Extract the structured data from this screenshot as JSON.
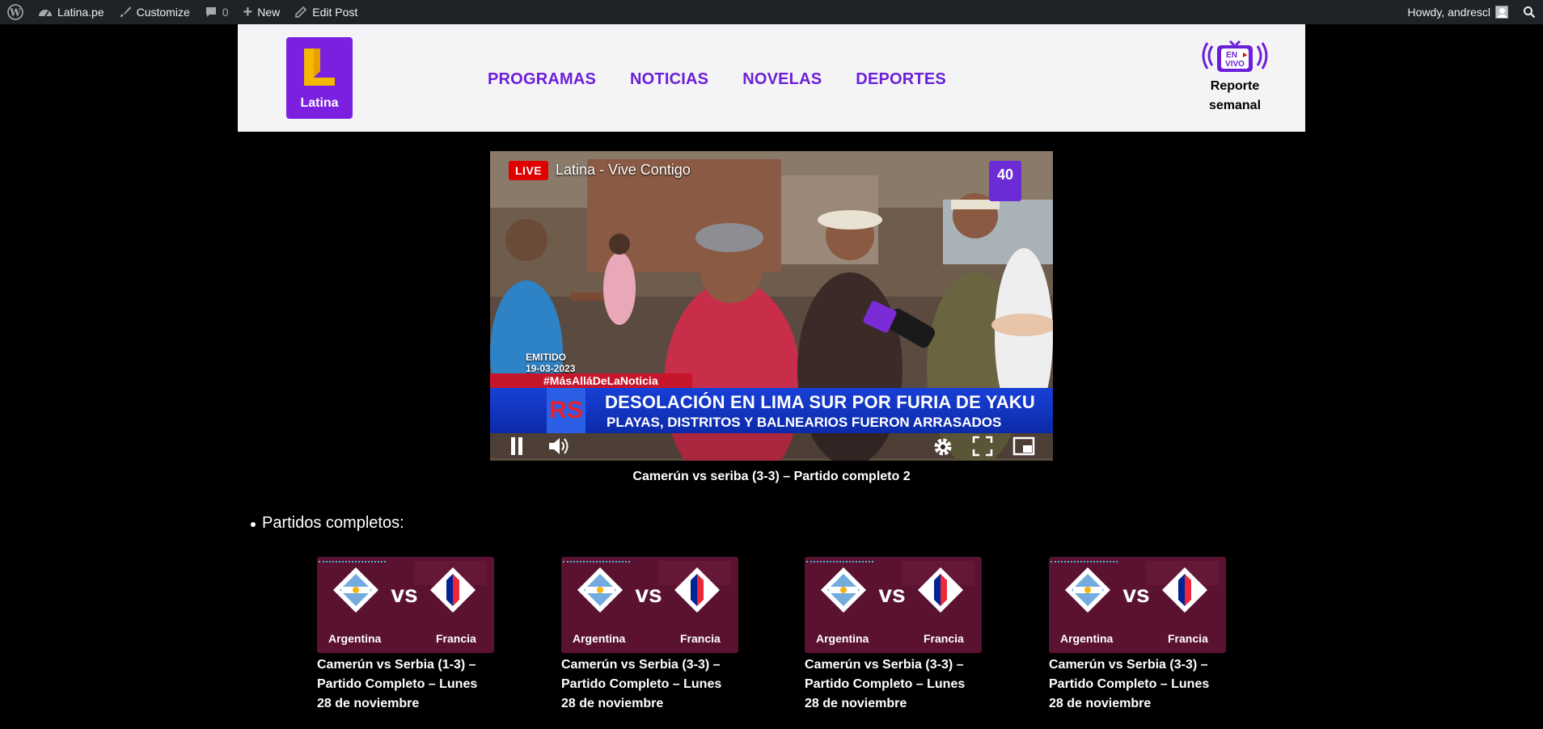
{
  "adminbar": {
    "site_name": "Latina.pe",
    "customize": "Customize",
    "comments_count": "0",
    "new": "New",
    "edit_post": "Edit Post",
    "greeting": "Howdy, andrescl"
  },
  "header": {
    "logo_text": "Latina",
    "nav": [
      "PROGRAMAS",
      "NOTICIAS",
      "NOVELAS",
      "DEPORTES"
    ],
    "envivo_badge": [
      "EN",
      "VIVO"
    ],
    "report_label": "Reporte semanal"
  },
  "player": {
    "live_badge": "LIVE",
    "stream_title": "Latina - Vive Contigo",
    "channel_badge": "40",
    "emitido_label": "EMITIDO",
    "emitido_date": "19-03-2023",
    "hashtag": "#MásAlláDeLaNoticia",
    "rs_logo": "RS",
    "headline_1": "DESOLACIÓN EN LIMA SUR POR FURIA DE YAKU",
    "headline_2": "PLAYAS, DISTRITOS Y BALNEARIOS FUERON ARRASADOS",
    "caption": "Camerún vs seriba (3-3) – Partido completo 2"
  },
  "section": {
    "title": "Partidos completos:"
  },
  "cards": [
    {
      "team_left": "Argentina",
      "vs": "vs",
      "team_right": "Francia",
      "title": "Camerún vs Serbia (1-3) – Partido Completo – Lunes 28 de noviembre"
    },
    {
      "team_left": "Argentina",
      "vs": "vs",
      "team_right": "Francia",
      "title": "Camerún vs Serbia (3-3) – Partido Completo – Lunes 28 de noviembre"
    },
    {
      "team_left": "Argentina",
      "vs": "vs",
      "team_right": "Francia",
      "title": "Camerún vs Serbia (3-3) – Partido Completo – Lunes 28 de noviembre"
    },
    {
      "team_left": "Argentina",
      "vs": "vs",
      "team_right": "Francia",
      "title": "Camerún vs Serbia (3-3) – Partido Completo – Lunes 28 de noviembre"
    }
  ],
  "colors": {
    "brand_purple": "#6b1fd8",
    "live_red": "#e00000",
    "adminbar_bg": "#1d2327"
  }
}
